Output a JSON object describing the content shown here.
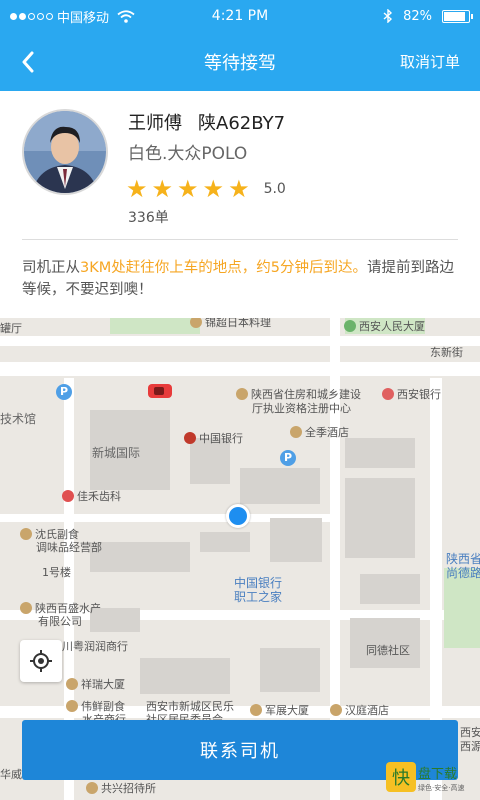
{
  "status": {
    "carrier": "中国移动",
    "time": "4:21 PM",
    "battery": "82%"
  },
  "nav": {
    "title": "等待接驾",
    "cancel": "取消订单"
  },
  "driver": {
    "name": "王师傅",
    "plate": "陕A62BY7",
    "car": "白色.大众POLO",
    "rating_value": 5.0,
    "score": "5.0",
    "orders": "336单"
  },
  "message": {
    "part1": "司机正从",
    "highlight": "3KM处赶往你上车的地点，约5分钟后到达。",
    "part2": "请提前到路边等候，不要迟到噢！"
  },
  "map": {
    "labels": {
      "l1": "罐厅",
      "l2": "锦超日本料理",
      "l3": "西安人民大厦",
      "l4": "东新街",
      "l5": "陕西省住房和城乡建设",
      "l6": "厅执业资格注册中心",
      "l7": "西安银行",
      "l8": "技术馆",
      "l9": "新城国际",
      "l10": "中国银行",
      "l11": "全季酒店",
      "l12": "佳禾齿科",
      "l13": "沈氏副食",
      "l14": "调味品经营部",
      "l15": "1号楼",
      "l16": "中国银行",
      "l17": "职工之家",
      "l18": "陕西省",
      "l19": "尚德路",
      "l20": "陕西百盛水产",
      "l21": "有限公司",
      "l22": "川粤润润商行",
      "l23": "同德社区",
      "l24": "祥瑞大厦",
      "l25": "伟鲜副食",
      "l26": "水产商行",
      "l27": "西安市新城区民乐",
      "l28": "社区居民委员会",
      "l29": "军展大厦",
      "l30": "汉庭酒店",
      "l31": "华威",
      "l32": "共兴招待所",
      "l33": "西安",
      "l34": "西源"
    }
  },
  "contact_button": "联系司机",
  "watermark": {
    "main": "快盘下载",
    "sub": "绿色 · 安全 · 高速"
  },
  "colors": {
    "primary": "#2aa8f0",
    "button": "#1e86d8",
    "accent": "#f6a623",
    "star": "#f6b21b"
  }
}
